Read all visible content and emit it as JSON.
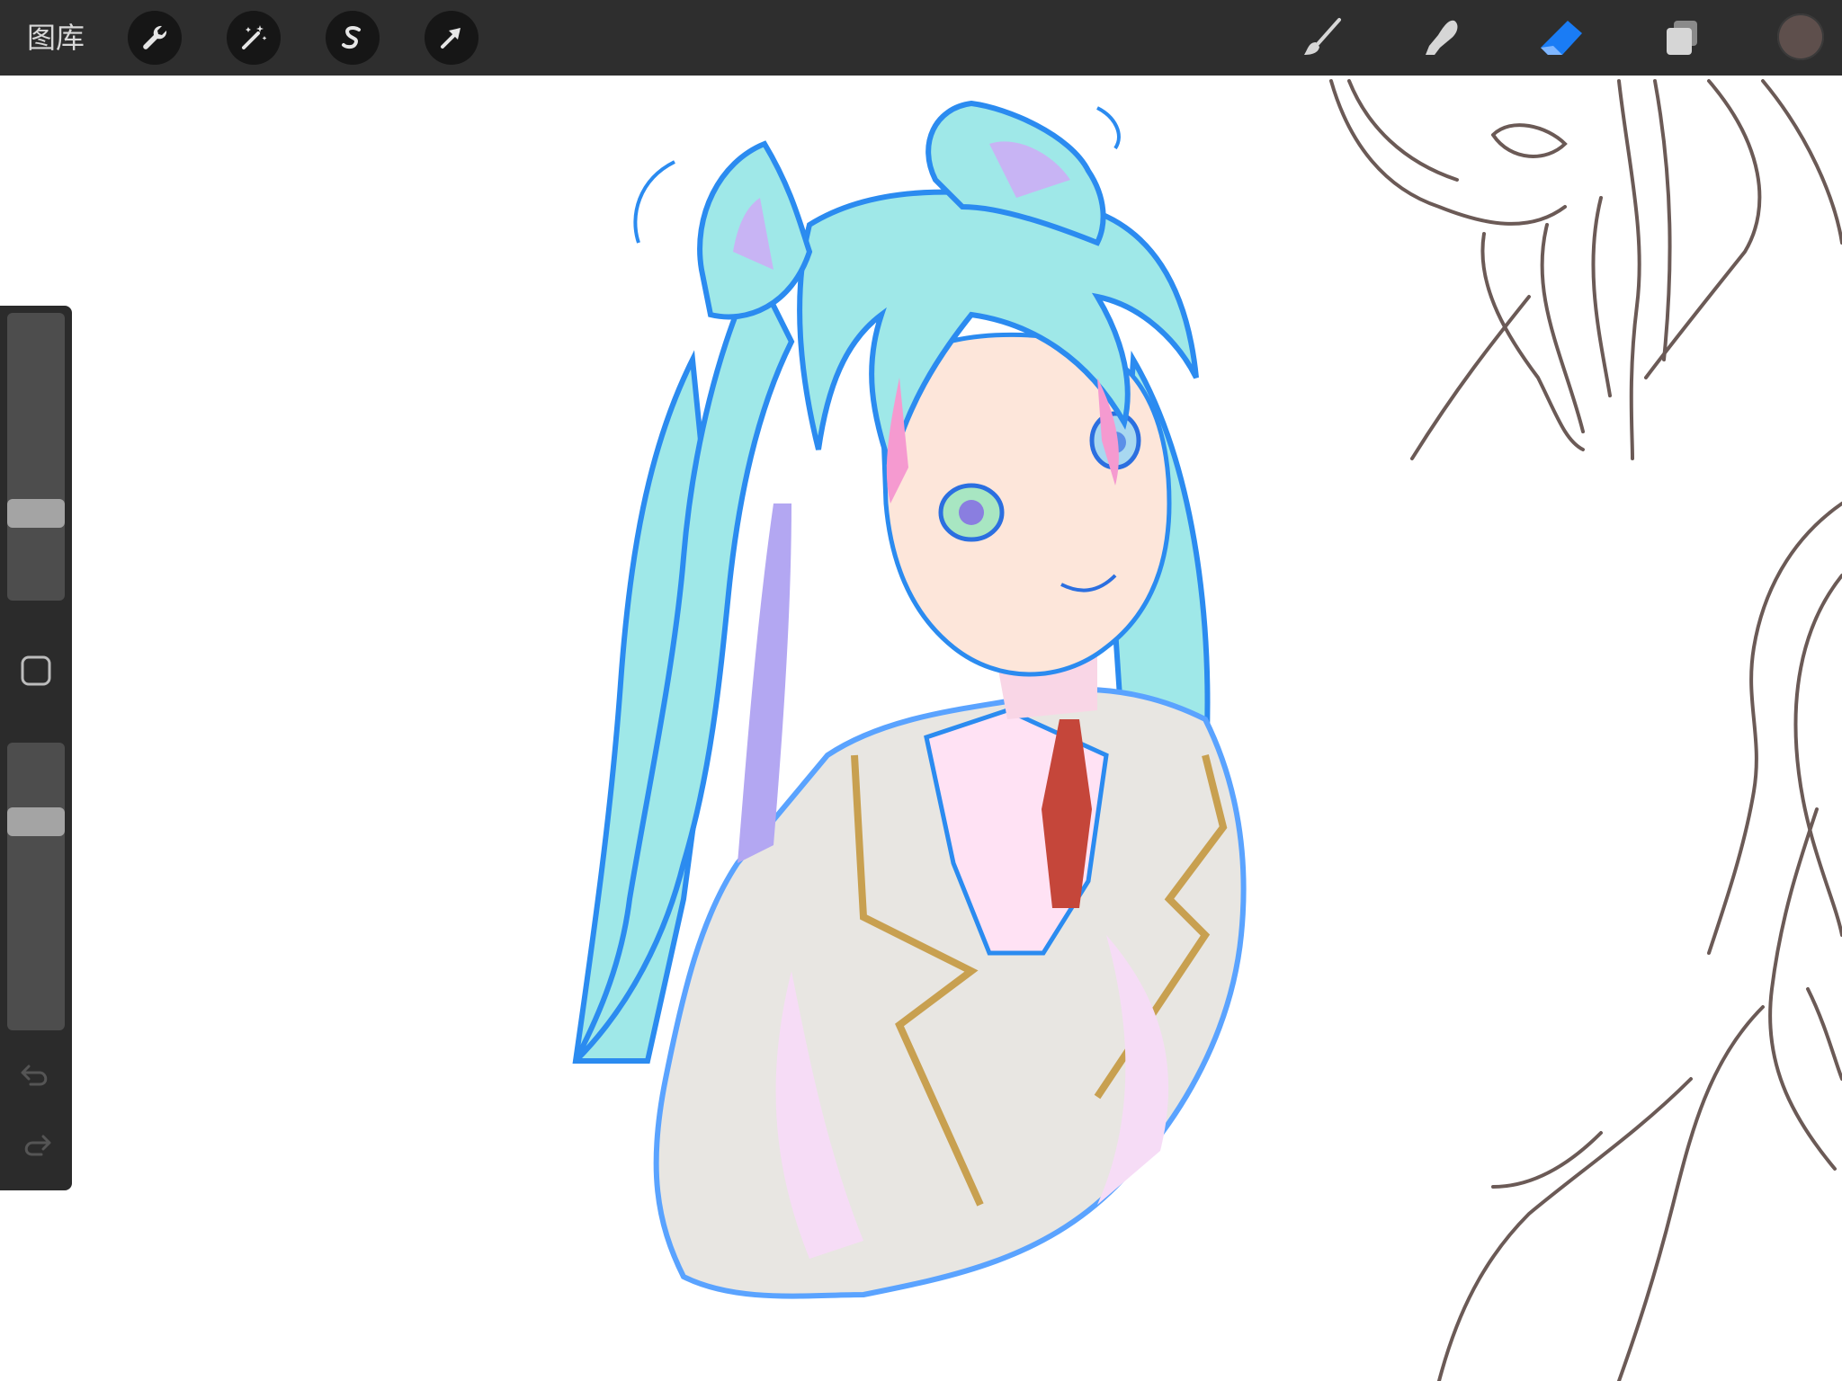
{
  "toolbar": {
    "gallery_label": "图库",
    "left_tools": [
      {
        "name": "actions",
        "icon": "wrench-icon"
      },
      {
        "name": "adjustments",
        "icon": "magic-wand-icon"
      },
      {
        "name": "selection",
        "icon": "selection-s-icon"
      },
      {
        "name": "transform",
        "icon": "arrow-cursor-icon"
      }
    ],
    "right_tools": [
      {
        "name": "brush",
        "icon": "brush-icon"
      },
      {
        "name": "smudge",
        "icon": "smudge-finger-icon"
      },
      {
        "name": "eraser",
        "icon": "eraser-icon",
        "active": true
      },
      {
        "name": "layers",
        "icon": "layers-icon"
      }
    ],
    "active_color": "#5e4f4c",
    "accent_color": "#1a7cf5"
  },
  "sidebar": {
    "brush_size_level": 0.28,
    "opacity_level": 0.75,
    "modify_icon": "square-modify-icon",
    "undo_icon": "undo-icon",
    "redo_icon": "redo-icon"
  },
  "canvas": {
    "background": "#ffffff",
    "artwork": "anime-girl-illustration",
    "sketch": "line-sketch"
  }
}
